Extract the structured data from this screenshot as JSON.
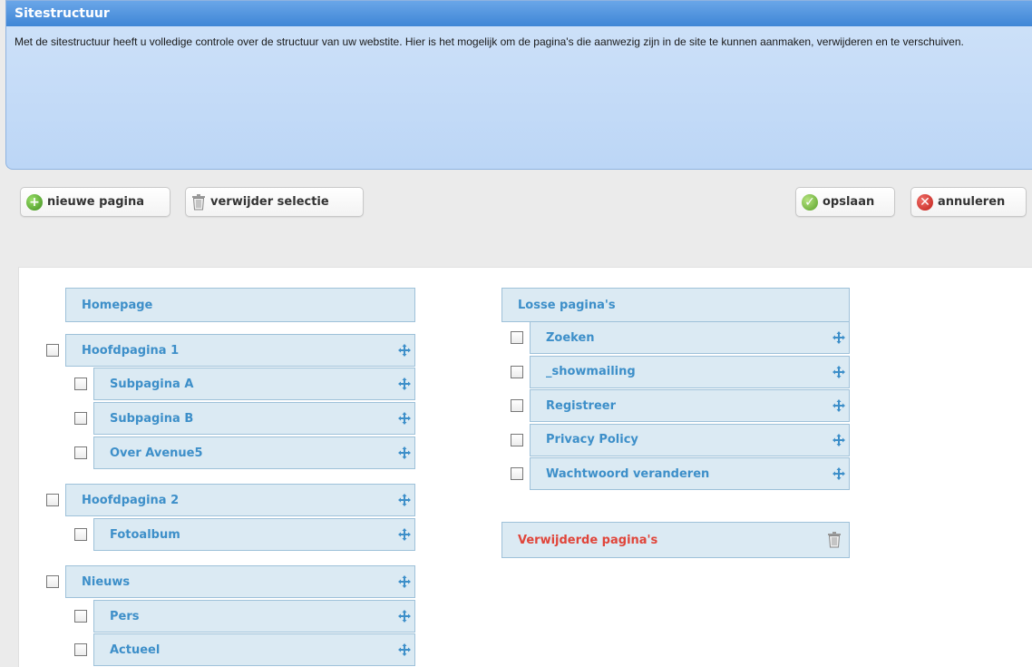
{
  "header": {
    "title": "Sitestructuur",
    "description": "Met de sitestructuur heeft u volledige controle over de structuur van uw webstite. Hier is het mogelijk om de pagina's die aanwezig zijn in de site te kunnen aanmaken, verwijderen en te verschuiven."
  },
  "toolbar": {
    "new_page": "nieuwe pagina",
    "delete_selection": "verwijder selectie",
    "save": "opslaan",
    "cancel": "annuleren"
  },
  "tree": {
    "homepage": "Homepage",
    "items": [
      {
        "label": "Hoofdpagina 1",
        "level": 0
      },
      {
        "label": "Subpagina A",
        "level": 1
      },
      {
        "label": "Subpagina B",
        "level": 1
      },
      {
        "label": "Over Avenue5",
        "level": 1
      },
      {
        "label": "Hoofdpagina 2",
        "level": 0
      },
      {
        "label": "Fotoalbum",
        "level": 1
      },
      {
        "label": "Nieuws",
        "level": 0
      },
      {
        "label": "Pers",
        "level": 1
      },
      {
        "label": "Actueel",
        "level": 1
      }
    ]
  },
  "loose_pages": {
    "title": "Losse pagina's",
    "items": [
      {
        "label": "Zoeken"
      },
      {
        "label": "_showmailing"
      },
      {
        "label": "Registreer"
      },
      {
        "label": "Privacy Policy"
      },
      {
        "label": "Wachtwoord veranderen"
      }
    ]
  },
  "deleted_pages": {
    "title": "Verwijderde pagina's"
  },
  "colors": {
    "accent": "#3d8fc9",
    "deleted": "#e0453a"
  }
}
